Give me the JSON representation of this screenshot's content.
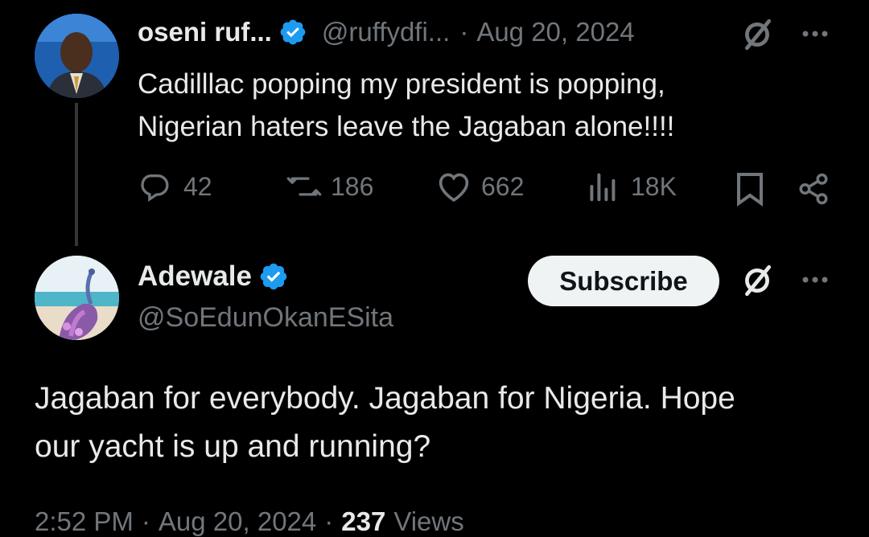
{
  "parent_post": {
    "display_name": "oseni ruf...",
    "handle": "@ruffydfi...",
    "separator": "·",
    "date": "Aug 20, 2024",
    "text_line1": "Cadilllac popping my president is popping,",
    "text_line2": "Nigerian haters leave the Jagaban alone!!!!",
    "replies": "42",
    "reposts": "186",
    "likes": "662",
    "views": "18K"
  },
  "reply_post": {
    "display_name": "Adewale",
    "handle": "@SoEdunOkanESita",
    "subscribe_label": "Subscribe",
    "text_line1": "Jagaban for everybody. Jagaban for Nigeria. Hope",
    "text_line2": "our yacht is up and running?",
    "time": "2:52 PM",
    "dot": "·",
    "date": "Aug 20, 2024",
    "dot2": "·",
    "views_count": "237",
    "views_label": "Views"
  },
  "colors": {
    "background": "#000000",
    "text_primary": "#e7e9ea",
    "text_muted": "#71767b",
    "verified_blue": "#1d9bf0",
    "subscribe_bg": "#eff3f4"
  },
  "icons": [
    "verified-badge-icon",
    "grok-icon",
    "more-icon",
    "reply-icon",
    "repost-icon",
    "like-icon",
    "views-icon",
    "bookmark-icon",
    "share-icon"
  ]
}
